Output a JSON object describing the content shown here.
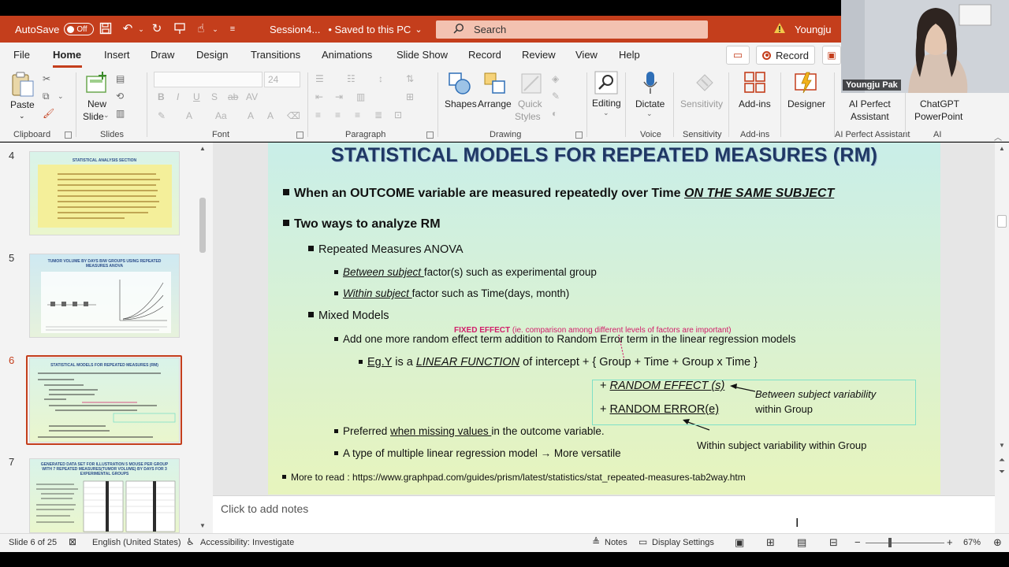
{
  "titlebar": {
    "autosave_label": "AutoSave",
    "autosave_state": "Off",
    "doc_title": "Session4...",
    "save_status": "• Saved to this PC",
    "search_placeholder": "Search",
    "user": "Youngju",
    "accent": "#c43e1c"
  },
  "menu": {
    "items": [
      "File",
      "Home",
      "Insert",
      "Draw",
      "Design",
      "Transitions",
      "Animations",
      "Slide Show",
      "Record",
      "Review",
      "View",
      "Help"
    ],
    "active": "Home",
    "record_button": "Record"
  },
  "ribbon": {
    "clipboard": {
      "paste": "Paste",
      "group": "Clipboard"
    },
    "slides": {
      "new_slide": "New",
      "new_slide_2": "Slide",
      "group": "Slides"
    },
    "font": {
      "size": "24",
      "group": "Font"
    },
    "paragraph": {
      "group": "Paragraph"
    },
    "drawing": {
      "shapes": "Shapes",
      "arrange": "Arrange",
      "quick_styles_1": "Quick",
      "quick_styles_2": "Styles",
      "group": "Drawing"
    },
    "editing": {
      "label": "Editing"
    },
    "voice": {
      "dictate": "Dictate",
      "group": "Voice"
    },
    "sensitivity": {
      "label": "Sensitivity",
      "group": "Sensitivity"
    },
    "addins": {
      "label": "Add-ins",
      "group": "Add-ins"
    },
    "designer": {
      "label": "Designer"
    },
    "ai_perfect": {
      "label_1": "AI Perfect",
      "label_2": "Assistant",
      "group": "AI Perfect Assistant"
    },
    "chatgpt": {
      "label_1": "ChatGPT",
      "label_2": "PowerPoint",
      "group": "AI"
    }
  },
  "video": {
    "name": "Youngju Pak"
  },
  "thumbnails": [
    {
      "num": "4",
      "title": "STATISTICAL ANALYSIS SECTION"
    },
    {
      "num": "5",
      "title": "TUMOR VOLUME BY DAYS B/W GROUPS USING REPEATED MEASURES ANOVA"
    },
    {
      "num": "6",
      "title": "STATISTICAL MODELS FOR REPEATED MEASURES (RM)"
    },
    {
      "num": "7",
      "title": "GENERATED DATA SET FOR ILLUSTRATION 5 MOUSE PER GROUP WITH 7 REPEATED MEASURES(TUMOR VOLUME) BY DAYS FOR 3 EXPERIMENTAL GROUPS"
    }
  ],
  "slide": {
    "title": "STATISTICAL MODELS FOR REPEATED MEASURES (RM)",
    "b1_pre": "When an OUTCOME variable are measured repeatedly over Time ",
    "b1_ul": "ON THE SAME SUBJECT",
    "b2": "Two ways to analyze RM",
    "rm_anova": "Repeated Measures ANOVA",
    "between_ul": "Between subject ",
    "between_rest": "factor(s) such as experimental group",
    "within_ul": "Within subject ",
    "within_rest": "factor such as Time(days, month)",
    "mixed": "Mixed Models",
    "fixed_effect_label": "FIXED EFFECT",
    "fixed_effect_note": " (ie. comparison among different levels of factors are important)",
    "add_term": "Add one more random effect term addition to Random Error term  in the linear regression models",
    "eg_pre": "Eg.Y",
    "eg_mid": " is a ",
    "eg_lf": "LINEAR FUNCTION",
    "eg_post": " of intercept + { Group + Time + Group x Time }",
    "random_effect": "RANDOM EFFECT (s)",
    "random_error": "RANDOM ERROR(e)",
    "between_var": "Between subject variability",
    "within_group": "within Group",
    "preferred_pre": "Preferred ",
    "preferred_ul": "when missing values ",
    "preferred_post": "in the outcome variable.",
    "type_line": "A type of multiple linear regression model → More versatile",
    "within_var": "Within subject variability within Group",
    "more_to_read": "More to read : https://www.graphpad.com/guides/prism/latest/statistics/stat_repeated-measures-tab2way.htm"
  },
  "notes_placeholder": "Click to add notes",
  "status": {
    "slide_info": "Slide 6 of 25",
    "language": "English (United States)",
    "accessibility": "Accessibility: Investigate",
    "notes": "Notes",
    "display": "Display Settings",
    "zoom": "67%"
  }
}
